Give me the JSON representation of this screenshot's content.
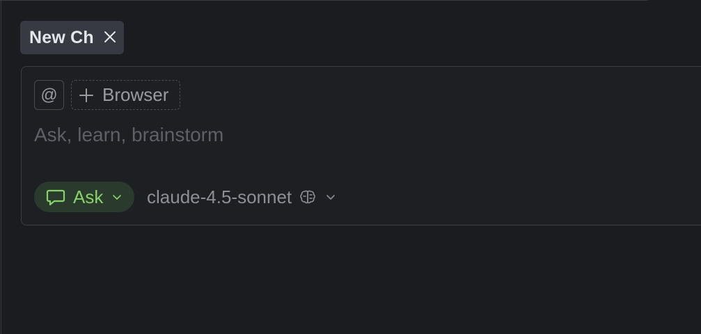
{
  "tab": {
    "title": "New Ch",
    "close_icon": "close-icon"
  },
  "composer": {
    "mention_label": "@",
    "browser_label": "Browser",
    "placeholder": "Ask, learn, brainstorm",
    "mode": {
      "label": "Ask",
      "icon": "chat-bubble-icon",
      "color": "#86d36a"
    },
    "model": {
      "label": "claude-4.5-sonnet",
      "icon": "brain-icon"
    }
  },
  "colors": {
    "background": "#1b1c20",
    "tab_bg": "#373a42",
    "mode_bg": "#2a3a2c",
    "accent_green": "#86d36a"
  }
}
